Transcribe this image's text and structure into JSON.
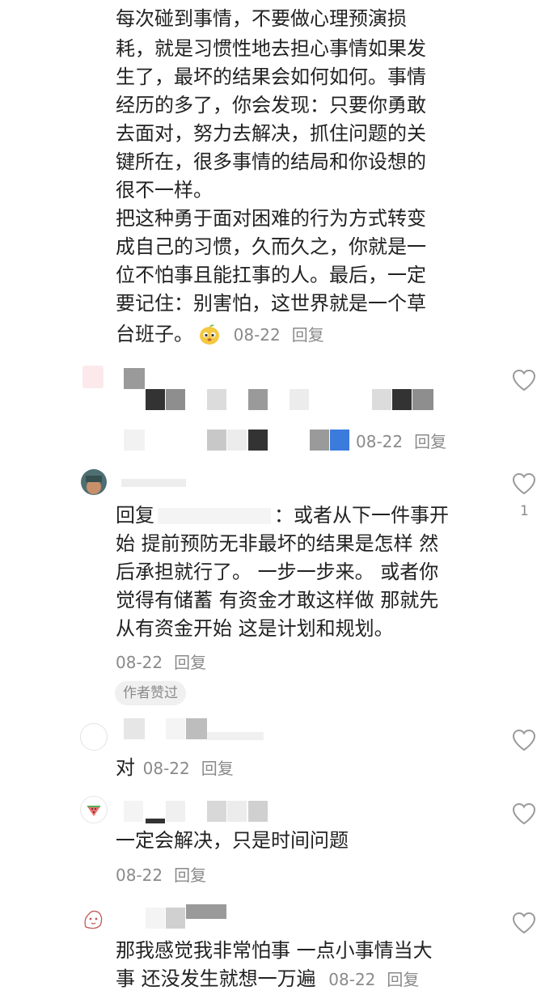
{
  "first_comment": {
    "lines": [
      "每次碰到事情，不要做心理预演损",
      "耗，就是习惯性地去担心事情如果发",
      "生了，最坏的结果会如何如何。事情",
      "经历的多了，你会发现：只要你勇敢",
      "去面对，努力去解决，抓住问题的关",
      "键所在，很多事情的结局和你设想的",
      "很不一样。",
      "把这种勇于面对困难的行为方式转变",
      "成自己的习惯，久而久之，你就是一",
      "位不怕事且能扛事的人。最后，一定",
      "要记住：别害怕，这世界就是一个草",
      "台班子。"
    ],
    "emoji": "mango-face-emoji",
    "date": "08-22",
    "reply": "回复"
  },
  "second_comment": {
    "date": "08-22",
    "reply": "回复"
  },
  "third_comment": {
    "reply_prefix": "回复",
    "line1_suffix": "：或者从下一件事开",
    "lines": [
      "始 提前预防无非最坏的结果是怎样 然",
      "后承担就行了。 一步一步来。 或者你",
      "觉得有储蓄 有资金才敢这样做 那就先",
      "从有资金开始 这是计划和规划。"
    ],
    "date": "08-22",
    "reply": "回复",
    "author_liked": "作者赞过",
    "like_count": "1"
  },
  "fourth_comment": {
    "text": "对",
    "date": "08-22",
    "reply": "回复"
  },
  "fifth_comment": {
    "text": "一定会解决，只是时间问题",
    "date": "08-22",
    "reply": "回复"
  },
  "sixth_comment": {
    "line1": "那我感觉我非常怕事 一点小事情当大",
    "line2": "事 还没发生就想一万遍",
    "date": "08-22",
    "reply": "回复"
  },
  "colors": {
    "text": "#222222",
    "meta": "#8a8a8a",
    "icon": "#9a9a9a"
  }
}
